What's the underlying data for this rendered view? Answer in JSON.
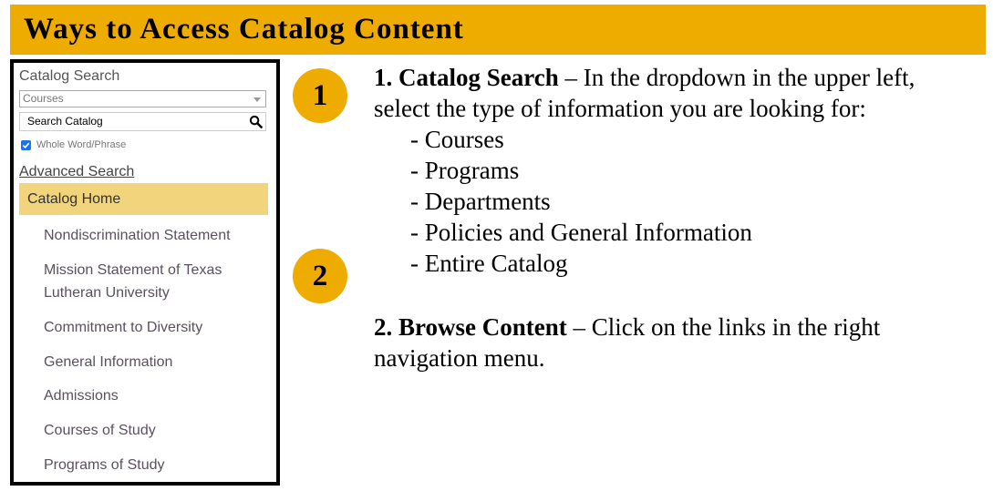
{
  "banner": {
    "title": "Ways to Access Catalog Content"
  },
  "colors": {
    "accent": "#eeac00",
    "highlight": "#f1d47b",
    "checkbox": "#1a73e8"
  },
  "sidebar": {
    "search_heading": "Catalog Search",
    "select_value": "Courses",
    "search_placeholder": "Search Catalog",
    "search_icon": "search-icon",
    "checkbox_label": "Whole Word/Phrase",
    "checkbox_checked": true,
    "advanced_search": "Advanced Search",
    "home": "Catalog Home",
    "items": [
      {
        "label": "Nondiscrimination Statement"
      },
      {
        "label": "Mission Statement of Texas Lutheran University"
      },
      {
        "label": "Commitment to Diversity"
      },
      {
        "label": "General Information"
      },
      {
        "label": "Admissions"
      },
      {
        "label": "Courses of Study"
      },
      {
        "label": "Programs of Study"
      }
    ]
  },
  "steps": [
    {
      "number": "1",
      "title": "1. Catalog Search",
      "dash": " – ",
      "text_line1": "In the dropdown in the upper left,",
      "text_line2": "select the type of information you are looking for:",
      "bullets": [
        "- Courses",
        "- Programs",
        "- Departments",
        "- Policies and General Information",
        "- Entire Catalog"
      ]
    },
    {
      "number": "2",
      "title": "2. Browse Content",
      "dash": " – ",
      "text_line1": "Click on the links in the right",
      "text_line2": "navigation menu."
    }
  ]
}
